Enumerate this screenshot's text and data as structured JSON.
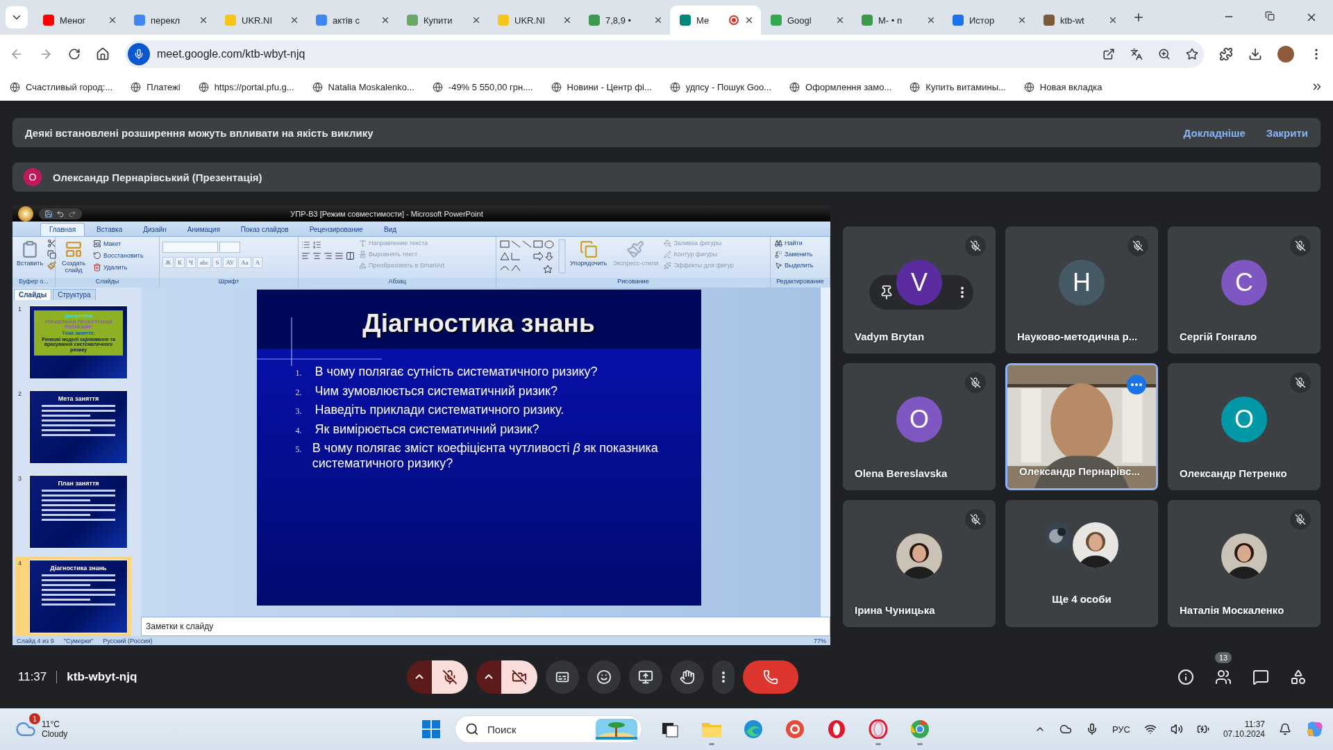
{
  "browser": {
    "tabs": [
      {
        "title": "Меног",
        "selected": false,
        "recording": false,
        "color": "#ff0000"
      },
      {
        "title": "перекл",
        "selected": false,
        "recording": false,
        "color": "#4285f4"
      },
      {
        "title": "UKR.NI",
        "selected": false,
        "recording": false,
        "color": "#f5c518"
      },
      {
        "title": "актів с",
        "selected": false,
        "recording": false,
        "color": "#4285f4"
      },
      {
        "title": "Купити",
        "selected": false,
        "recording": false,
        "color": "#6aa86a"
      },
      {
        "title": "UKR.NI",
        "selected": false,
        "recording": false,
        "color": "#f5c518"
      },
      {
        "title": "7,8,9 •",
        "selected": false,
        "recording": false,
        "color": "#3c9a4f"
      },
      {
        "title": "Ме",
        "selected": true,
        "recording": true,
        "color": "#00897b"
      },
      {
        "title": "Googl",
        "selected": false,
        "recording": false,
        "color": "#34a853"
      },
      {
        "title": "М- • n",
        "selected": false,
        "recording": false,
        "color": "#3c9a4f"
      },
      {
        "title": "Истор",
        "selected": false,
        "recording": false,
        "color": "#1a73e8"
      },
      {
        "title": "ktb-wt",
        "selected": false,
        "recording": false,
        "color": "#7b5a3a"
      }
    ],
    "address": "meet.google.com/ktb-wbyt-njq",
    "bookmarks": [
      "Счастливый город:...",
      "Платежі",
      "https://portal.pfu.g...",
      "Natalia Moskalenko...",
      "-49% 5 550,00 грн....",
      "Новини - Центр фі...",
      "удпсу - Пошук Goo...",
      "Оформлення замо...",
      "Купить витамины...",
      "Новая вкладка"
    ]
  },
  "meet": {
    "banner": {
      "message": "Деякі встановлені розширення можуть впливати на якість виклику",
      "links": [
        "Докладніше",
        "Закрити"
      ]
    },
    "presenter": {
      "initial": "О",
      "color": "#c2185b",
      "label": "Олександр Пернарівський (Презентація)"
    },
    "powerpoint": {
      "title": "УПР-В3 [Режим совместимости] - Microsoft PowerPoint",
      "ribbon_tabs": [
        {
          "label": "Главная",
          "selected": true
        },
        {
          "label": "Вставка",
          "selected": false
        },
        {
          "label": "Дизайн",
          "selected": false
        },
        {
          "label": "Анимация",
          "selected": false
        },
        {
          "label": "Показ слайдов",
          "selected": false
        },
        {
          "label": "Рецензирование",
          "selected": false
        },
        {
          "label": "Вид",
          "selected": false
        }
      ],
      "clipboard": {
        "paste": "Вставить",
        "group": "Буфер о..."
      },
      "slides_group": {
        "new_slide": "Создать слайд",
        "layout": "Макет",
        "reset": "Восстановить",
        "delete": "Удалить",
        "group": "Слайды"
      },
      "font_group": {
        "format_buttons": [
          "Ж",
          "К",
          "Ч",
          "abc",
          "S",
          "AV",
          "Aa",
          "A"
        ],
        "group": "Шрифт"
      },
      "paragraph_group": {
        "text_direction": "Направление текста",
        "align_text": "Выровнять текст",
        "smartart": "Преобразовать в SmartArt",
        "group": "Абзац"
      },
      "drawing_group": {
        "arrange": "Упорядочить",
        "quick_styles": "Экспресс-стили",
        "fill": "Заливка фигуры",
        "outline": "Контур фигуры",
        "effects": "Эффекты для фигур",
        "group": "Рисование"
      },
      "editing_group": {
        "find": "Найти",
        "replace": "Заменить",
        "select": "Выделить",
        "group": "Редактирование"
      },
      "pane_tabs": [
        {
          "label": "Слайды",
          "selected": true
        },
        {
          "label": "Структура",
          "selected": false
        }
      ],
      "thumbnails": [
        {
          "number": "1",
          "kind": "cover",
          "selected": false,
          "lines": [
            {
              "text": "дисципліна",
              "color": "#40e0d0"
            },
            {
              "text": "УПРАВЛІННЯ ПРОЄКТНИМИ РИЗИКАМИ",
              "color": "#8e5fb0"
            },
            {
              "text": "Тема заняття:",
              "color": "#0b5fa0"
            },
            {
              "text": "Ринкові моделі оцінювання та врахування систематичного ризику",
              "color": "#10253a"
            }
          ]
        },
        {
          "number": "2",
          "kind": "content",
          "selected": false,
          "title": "Мета заняття"
        },
        {
          "number": "3",
          "kind": "content",
          "selected": false,
          "title": "План заняття"
        },
        {
          "number": "4",
          "kind": "content",
          "selected": true,
          "title": "Діагностика знань"
        }
      ],
      "slide": {
        "title": "Діагностика знань",
        "items": [
          {
            "number": "1.",
            "text": "В чому полягає сутність систематичного ризику?"
          },
          {
            "number": "2.",
            "text": "Чим зумовлюється систематичний ризик?"
          },
          {
            "number": "3.",
            "text": "Наведіть приклади систематичного ризику."
          },
          {
            "number": "4.",
            "text": "Як вимірюється систематичний ризик?"
          },
          {
            "number": "5.",
            "text": "В чому полягає зміст коефіцієнта чутливості *β* як показника систематичного ризику?"
          }
        ]
      },
      "notes_placeholder": "Заметки к слайду",
      "status": [
        "Слайд 4 из 9",
        "\"Сумерки\"",
        "Русский (Россия)"
      ],
      "zoom": "77%"
    },
    "participants": [
      {
        "name": "Vadym Brytan",
        "kind": "initial",
        "initial": "V",
        "color": "#5b2ca0",
        "muted": true,
        "highlighted": false,
        "hovered": true
      },
      {
        "name": "Науково-методична р...",
        "kind": "initial",
        "initial": "Н",
        "color": "#455a64",
        "muted": true,
        "highlighted": false,
        "hovered": false
      },
      {
        "name": "Сергій Гонгало",
        "kind": "initial",
        "initial": "С",
        "color": "#7e57c2",
        "muted": true,
        "highlighted": false,
        "hovered": false
      },
      {
        "name": "Olena Bereslavska",
        "kind": "initial",
        "initial": "О",
        "color": "#7e57c2",
        "muted": true,
        "highlighted": false,
        "hovered": false
      },
      {
        "name": "Олександр Пернарівс...",
        "kind": "video",
        "muted": false,
        "highlighted": true,
        "hovered": false
      },
      {
        "name": "Олександр Петренко",
        "kind": "initial",
        "initial": "О",
        "color": "#0097a7",
        "muted": true,
        "highlighted": false,
        "hovered": false
      },
      {
        "name": "Ірина Чуницька",
        "muted": true,
        "highlighted": false,
        "hovered": false
      },
      {
        "name": "Ще 4 особи",
        "kind": "more",
        "muted": false,
        "highlighted": false,
        "hovered": false
      },
      {
        "name": "Наталія Москаленко",
        "muted": true,
        "highlighted": false,
        "hovered": false
      }
    ],
    "bottom_bar": {
      "time": "11:37",
      "code": "ktb-wbyt-njq",
      "mic_on": false,
      "camera_on": false,
      "people_count": "13"
    }
  },
  "taskbar": {
    "weather": {
      "badge": "1",
      "temp": "11°C",
      "condition": "Cloudy"
    },
    "search_placeholder": "Поиск",
    "apps": [
      {
        "running": false
      },
      {
        "running": true
      },
      {
        "running": false
      },
      {
        "running": false
      },
      {
        "running": false
      },
      {
        "running": true
      },
      {
        "running": true
      }
    ],
    "language": "РУС",
    "time": "11:37",
    "date": "07.10.2024"
  }
}
